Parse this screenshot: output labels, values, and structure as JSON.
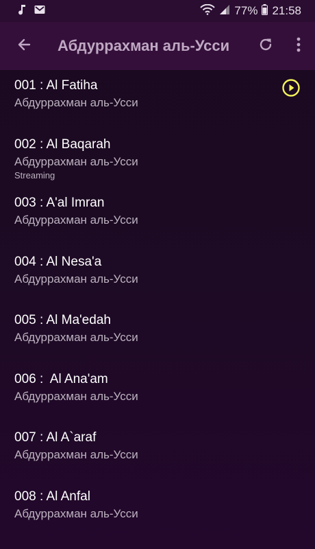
{
  "status_bar": {
    "battery": "77%",
    "time": "21:58",
    "icons": [
      "music-note-icon",
      "mail-icon",
      "wifi-icon",
      "signal-icon"
    ]
  },
  "app_bar": {
    "title": "Абдуррахман аль-Усси",
    "icons": [
      "back-arrow-icon",
      "refresh-icon",
      "more-vert-icon"
    ]
  },
  "tracks": [
    {
      "title": "001 : Al Fatiha",
      "artist": "Абдуррахман аль-Усси",
      "status": ""
    },
    {
      "title": "002 : Al Baqarah",
      "artist": "Абдуррахман аль-Усси",
      "status": "Streaming"
    },
    {
      "title": "003 : A'al Imran",
      "artist": "Абдуррахман аль-Усси",
      "status": ""
    },
    {
      "title": "004 : Al Nesa'a",
      "artist": "Абдуррахман аль-Усси",
      "status": ""
    },
    {
      "title": "005 : Al Ma'edah",
      "artist": "Абдуррахман аль-Усси",
      "status": ""
    },
    {
      "title": "006 :  Al Ana'am",
      "artist": "Абдуррахман аль-Усси",
      "status": ""
    },
    {
      "title": "007 : Al A`araf",
      "artist": "Абдуррахман аль-Усси",
      "status": ""
    },
    {
      "title": "008 : Al Anfal",
      "artist": "Абдуррахман аль-Усси",
      "status": ""
    }
  ],
  "colors": {
    "background": "#1d0a24",
    "app_bar": "#340f3a",
    "status_bar": "#2a0d31",
    "play_accent": "#f2f25a"
  }
}
